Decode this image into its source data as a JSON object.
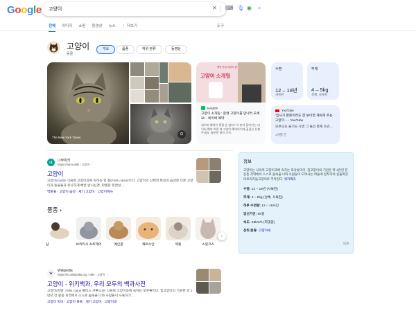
{
  "search": {
    "query": "고양이"
  },
  "tabs": [
    "전체",
    "이미지",
    "쇼핑",
    "동영상",
    "뉴스",
    "⋮ 더보기"
  ],
  "tools_label": "도구",
  "entity": {
    "title": "고양이",
    "subtitle": "동물 ⋮"
  },
  "chips": [
    "개요",
    "품종",
    "하위 분류",
    "동영상"
  ],
  "image_caption": "The New York Times",
  "book_card": {
    "top_text": "매력 만점 고양이 탐구서",
    "title": "고양이 소개팅",
    "source": "NAVER",
    "title_text": "고양이 소개팅 : 운명 고양이를 만나러 오세요! - 네이버 예약",
    "snippet": "네이버 예약이 편할 순 없다? 이 분야 찾아가는 네이버 예약 하면 대 고양이 예약하기에 꿈같은 유형 주세요. 충분한 향이 가득."
  },
  "stats": [
    {
      "label": "수명",
      "value": "12 – 18년",
      "sub": "사육된"
    },
    {
      "label": "무게",
      "value": "4 – 5kg",
      "sub": "성체, 사육된"
    }
  ],
  "yt_card": {
    "source": "YouTube",
    "text": "'집사가 잘못이라도 한 보이면 계속해 주는 고양이... - YouTube",
    "snippet": "모르모도 슬기도 나면 그 몰건 존재 쓰죠...",
    "meta": "1개월 전"
  },
  "result1": {
    "fav": "나",
    "source": "나무위키",
    "url": "https://namu.wiki › 고양이 ⋮",
    "title": "고양이",
    "snippet": "고양이(cat)는 식육목 고양이과에 속하는 한 종(Felis catus)이다. 고양이의 신체적 특성과 습성은 다른 고양이과 동물들과 유사하게 빠른 반사신경, 탁월한 유연성, ...",
    "links": "역문표 · 고양이 습성 · 세기 고양이 · 고양이에사"
  },
  "breeds": {
    "title": "품종",
    "items": [
      "샴",
      "브리티시 쇼트헤어",
      "메인쿤",
      "페르시안",
      "랙돌",
      "스핑크스"
    ],
    "colors": [
      "#d9c7b0",
      "#9aa0a8",
      "#c69a66",
      "#e8b47a",
      "#d8cfc4",
      "#c9b7b2"
    ]
  },
  "result2": {
    "fav": "W",
    "source": "Wikipedia",
    "url": "https://ko.wikipedia.org › wiki › 고양이 ⋮",
    "title": "고양이 - 위키백과, 우리 모두의 백과사전",
    "snippet": "고양이(학명: Felis catus 펠리스 카투스)는 식육목 고양이과에 속하는 포유류이다. 집고양이의 기원은 약 1만년 전 중동 지역에서 스스로 숨숙을 나와 사람들이 사육하기 ...",
    "links": "고양이 먹이 · 고양이 목록 · 세기 고양이 · 고양이과"
  },
  "info": {
    "title": "정보",
    "description": "고양이는 식육목 고양이과에 속하는 포유류이다. 집고양이의 기원은 약 1만년 전 중동 지역에서 스스로 숨숙을 나와 사람들이 모여사는 마을에 정착하며 길들여진 아프리카들고양이로 추측된다.",
    "wiki": "위키백과",
    "facts": [
      {
        "k": "수명:",
        "v": "12 – 18년 (사육된)"
      },
      {
        "k": "무게:",
        "v": "4 – 5kg (성체, 사육된)"
      },
      {
        "k": "하루 수면량:",
        "v": "12 – 16시간"
      },
      {
        "k": "임신기간:",
        "v": "65일"
      },
      {
        "k": "속도:",
        "v": "48km/h (최댓값)"
      },
      {
        "k": "상위 분류:",
        "v": "고양이속",
        "link": true
      }
    ],
    "feedback": "의견"
  }
}
